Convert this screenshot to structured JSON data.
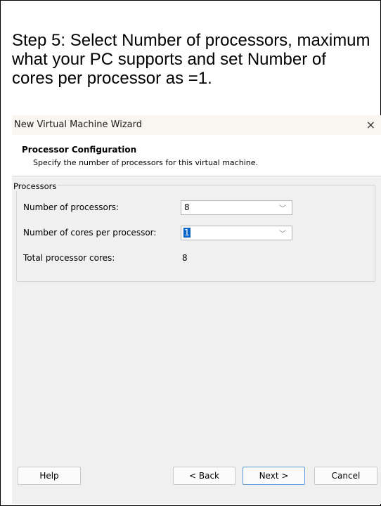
{
  "instruction": "Step 5: Select Number of processors, maximum what your PC supports and set Number of cores per processor as =1.",
  "dialog": {
    "title": "New Virtual Machine Wizard",
    "close_glyph": "×",
    "header_title": "Processor Configuration",
    "header_subtitle": "Specify the number of processors for this virtual machine."
  },
  "processors": {
    "group_label": "Processors",
    "num_processors_label": "Number of processors:",
    "num_processors_value": "8",
    "cores_per_processor_label": "Number of cores per processor:",
    "cores_per_processor_value": "1",
    "total_cores_label": "Total processor cores:",
    "total_cores_value": "8",
    "dropdown_glyph": "﹀"
  },
  "buttons": {
    "help": "Help",
    "back": "< Back",
    "next": "Next >",
    "cancel": "Cancel"
  }
}
